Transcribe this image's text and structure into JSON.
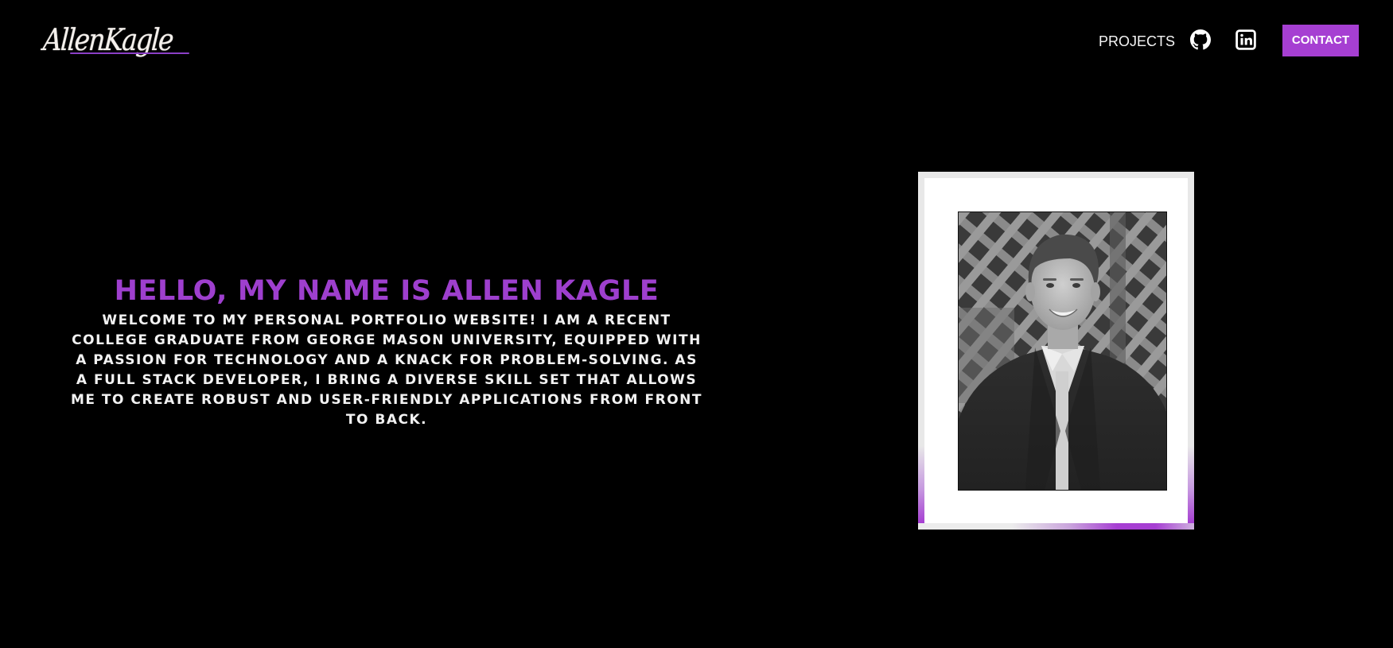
{
  "header": {
    "logo_text": "AllenKagle",
    "nav": {
      "projects_label": "PROJECTS",
      "github_icon": "github-icon",
      "linkedin_icon": "linkedin-icon",
      "contact_label": "CONTACT"
    }
  },
  "hero": {
    "title": "HELLO, MY NAME IS ALLEN KAGLE",
    "body": "WELCOME TO MY PERSONAL PORTFOLIO WEBSITE! I AM A RECENT COLLEGE GRADUATE FROM GEORGE MASON UNIVERSITY, EQUIPPED WITH A PASSION FOR TECHNOLOGY AND A KNACK FOR PROBLEM-SOLVING. AS A FULL STACK DEVELOPER, I BRING A DIVERSE SKILL SET THAT ALLOWS ME TO CREATE ROBUST AND USER-FRIENDLY APPLICATIONS FROM FRONT TO BACK."
  },
  "colors": {
    "background": "#000000",
    "accent": "#a63fd2",
    "title": "#9e3fce",
    "text": "#f2f2f2"
  }
}
